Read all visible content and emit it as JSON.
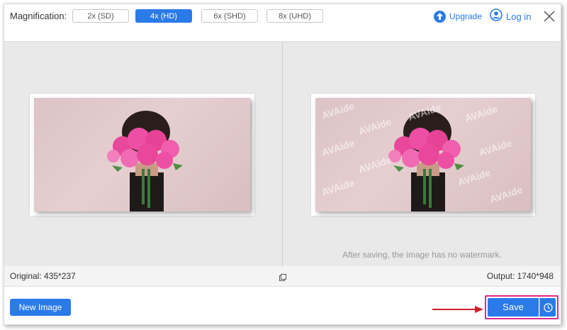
{
  "topbar": {
    "magnification_label": "Magnification:",
    "options": [
      "2x (SD)",
      "4x (HD)",
      "6x (SHD)",
      "8x (UHD)"
    ],
    "selected": "4x (HD)",
    "upgrade_label": "Upgrade",
    "login_label": "Log in"
  },
  "preview": {
    "watermark_text": "AVAide",
    "note": "After saving, the image has no watermark."
  },
  "info": {
    "original": "Original: 435*237",
    "output": "Output: 1740*948"
  },
  "actions": {
    "new_image_label": "New Image",
    "save_label": "Save"
  },
  "colors": {
    "accent": "#2a7ae8",
    "highlight": "#e0288a",
    "arrow": "#d0202a"
  },
  "icons": [
    "upload-arrow-icon",
    "user-icon",
    "close-icon",
    "compare-icon",
    "clock-icon"
  ]
}
